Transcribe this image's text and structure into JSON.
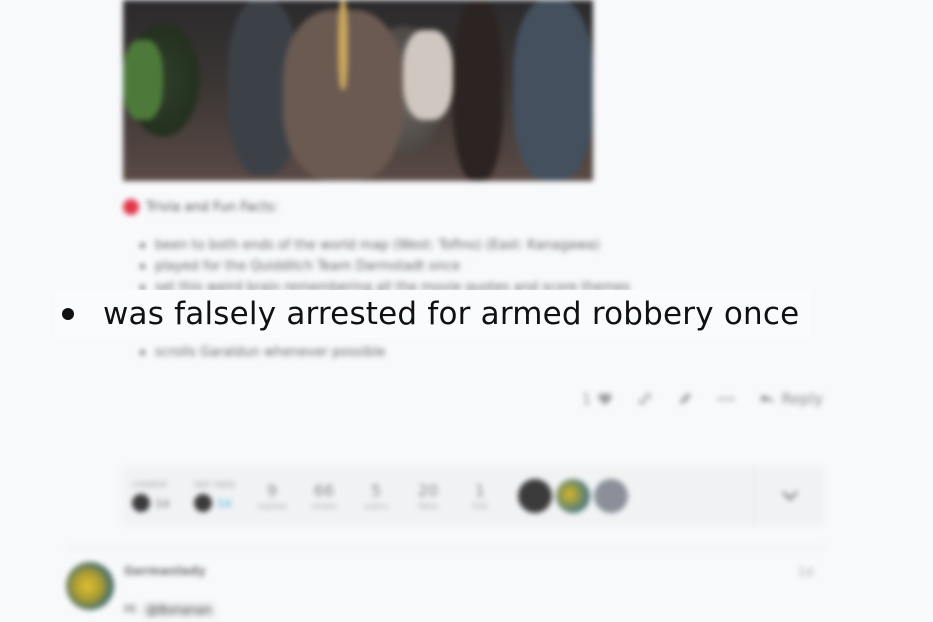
{
  "post": {
    "trivia_heading": "Trivia and Fun Facts:",
    "trivia_items": [
      "been to both ends of the world map (West: Tofino) (East: Kanagawa)",
      "played for the Quidditch Team Darmstadt once",
      "set this weird brain remembering all the movie quotes and score themes"
    ],
    "highlighted_item": "was falsely arrested for armed robbery once",
    "last_item": "scrolls Garaldun whenever possible",
    "actions": {
      "like_count": "1",
      "reply_label": "Reply"
    }
  },
  "topic_map": {
    "created_label": "created",
    "created_time": "1d",
    "last_reply_label": "last reply",
    "last_reply_time": "1d",
    "stats": [
      {
        "number": "9",
        "label": "replies"
      },
      {
        "number": "66",
        "label": "views"
      },
      {
        "number": "5",
        "label": "users"
      },
      {
        "number": "20",
        "label": "likes"
      },
      {
        "number": "1",
        "label": "link"
      }
    ],
    "toggle_icon": "chevron-down-icon"
  },
  "next_post": {
    "username": "Germanlady",
    "date": "1d",
    "greeting": "Hi",
    "mention": "@Bonanan"
  },
  "colors": {
    "trivia_icon": "#e0364a",
    "link_blue": "#33a4d8"
  }
}
